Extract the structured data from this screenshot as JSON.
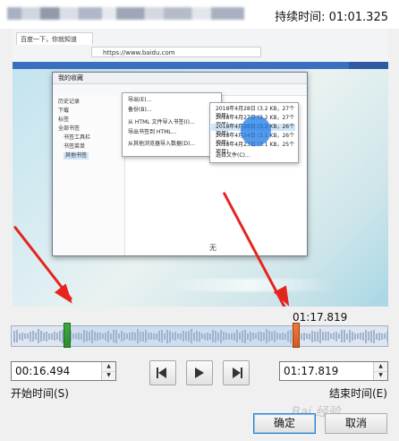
{
  "header": {
    "duration_label": "持续时间: 01:01.325"
  },
  "preview": {
    "browser_tab": "百度一下，你就知道",
    "address": "https://www.baidu.com",
    "dialog_title": "我的收藏",
    "sidebar_items": [
      "历史记录",
      "下载",
      "标签",
      "全部书签",
      "书签工具栏",
      "书签菜单",
      "其他书签"
    ],
    "menu_items": [
      "导出(E)...",
      "备份(B)...",
      "从 HTML 文件导入书签(I)...",
      "导出书签到 HTML...",
      "从其他浏览器导入数据(D)..."
    ],
    "submenu_items": [
      "2018年4月28日 (3.2 KB，27个项目)",
      "2018年4月27日 (3.2 KB，27个项目)",
      "2018年4月26日 (3.2 KB，26个项目)",
      "2018年4月24日 (3.1 KB，26个项目)",
      "2018年4月23日 (3.1 KB，25个项目)",
      "选择文件(C)..."
    ],
    "main_mark": "无"
  },
  "timeline": {
    "end_marker_time": "01:17.819",
    "start_fraction": 0.148,
    "end_fraction": 0.752
  },
  "controls": {
    "start_time_value": "00:16.494",
    "end_time_value": "01:17.819",
    "start_time_label": "开始时间(S)",
    "end_time_label": "结束时间(E)"
  },
  "buttons": {
    "ok": "确定",
    "cancel": "取消"
  },
  "watermark": "Bai 经验",
  "colors": {
    "start_marker": "#3cab3a",
    "end_marker": "#e86a2c",
    "arrow": "#e52420",
    "ok_border": "#2f7fd1"
  }
}
